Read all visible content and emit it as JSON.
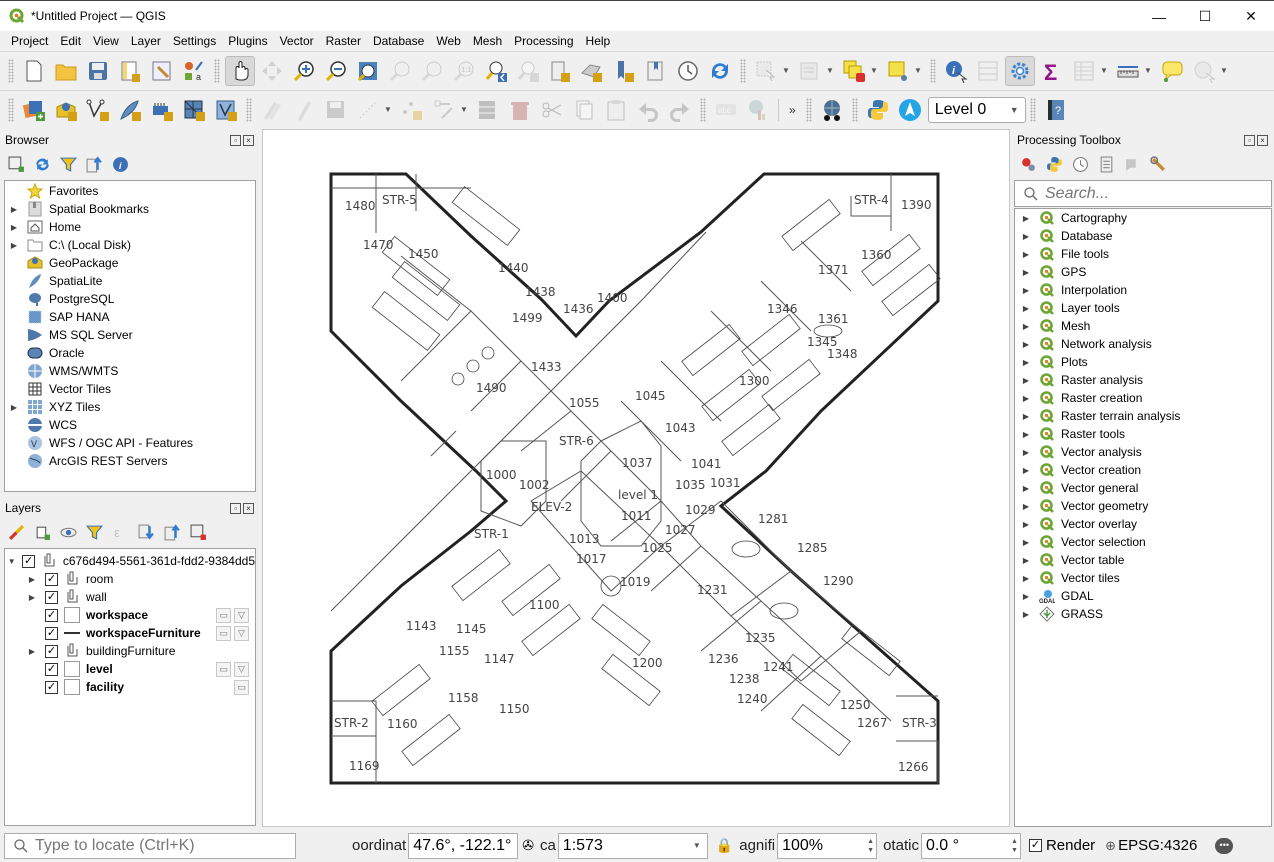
{
  "window": {
    "title": "*Untitled Project — QGIS",
    "minimize": "—",
    "maximize": "☐",
    "close": "✕"
  },
  "menubar": [
    "Project",
    "Edit",
    "View",
    "Layer",
    "Settings",
    "Plugins",
    "Vector",
    "Raster",
    "Database",
    "Web",
    "Mesh",
    "Processing",
    "Help"
  ],
  "toolbar_top": {
    "icons": [
      "new-project-icon",
      "open-project-icon",
      "save-project-icon",
      "new-print-layout-icon",
      "style-manager-icon",
      "layout-manager-icon",
      "pan-icon",
      "pan-to-selection-icon",
      "zoom-in-icon",
      "zoom-out-icon",
      "zoom-full-icon",
      "zoom-to-selection-icon",
      "zoom-to-layer-icon",
      "zoom-native-icon",
      "zoom-last-icon",
      "zoom-next-icon",
      "new-map-view-icon",
      "new-3d-map-icon",
      "new-bookmark-icon",
      "show-bookmarks-icon",
      "temporal-controller-icon",
      "refresh-icon",
      "select-features-icon",
      "select-by-value-icon",
      "deselect-icon",
      "select-by-location-icon",
      "identify-icon",
      "field-calculator-icon",
      "processing-toolbox-icon",
      "statistics-icon",
      "attribute-table-icon",
      "measure-icon",
      "map-tips-icon",
      "actions-icon"
    ],
    "active": "pan-icon"
  },
  "toolbar_bottom": {
    "level_selector": "Level 0",
    "more": "»"
  },
  "browser": {
    "title": "Browser",
    "items": [
      {
        "label": "Favorites",
        "icon": "star-icon",
        "expandable": false
      },
      {
        "label": "Spatial Bookmarks",
        "icon": "bookmark-icon",
        "expandable": true
      },
      {
        "label": "Home",
        "icon": "home-folder-icon",
        "expandable": true
      },
      {
        "label": "C:\\ (Local Disk)",
        "icon": "folder-icon",
        "expandable": true
      },
      {
        "label": "GeoPackage",
        "icon": "geopackage-icon",
        "expandable": false
      },
      {
        "label": "SpatiaLite",
        "icon": "feather-icon",
        "expandable": false
      },
      {
        "label": "PostgreSQL",
        "icon": "elephant-icon",
        "expandable": false
      },
      {
        "label": "SAP HANA",
        "icon": "hana-icon",
        "expandable": false
      },
      {
        "label": "MS SQL Server",
        "icon": "mssql-icon",
        "expandable": false
      },
      {
        "label": "Oracle",
        "icon": "oracle-icon",
        "expandable": false
      },
      {
        "label": "WMS/WMTS",
        "icon": "globe-icon",
        "expandable": false
      },
      {
        "label": "Vector Tiles",
        "icon": "grid-icon",
        "expandable": false
      },
      {
        "label": "XYZ Tiles",
        "icon": "tiles-icon",
        "expandable": true
      },
      {
        "label": "WCS",
        "icon": "wcs-globe-icon",
        "expandable": false
      },
      {
        "label": "WFS / OGC API - Features",
        "icon": "wfs-globe-icon",
        "expandable": false
      },
      {
        "label": "ArcGIS REST Servers",
        "icon": "arcgis-globe-icon",
        "expandable": false
      }
    ]
  },
  "layers": {
    "title": "Layers",
    "group": "c676d494-5561-361d-fdd2-9384dd5",
    "items": [
      {
        "label": "room",
        "type": "group",
        "bold": false,
        "checked": true,
        "expandable": true,
        "indicators": 0
      },
      {
        "label": "wall",
        "type": "group",
        "bold": false,
        "checked": true,
        "expandable": true,
        "indicators": 0
      },
      {
        "label": "workspace",
        "type": "polygon",
        "bold": true,
        "checked": true,
        "expandable": false,
        "indicators": 2
      },
      {
        "label": "workspaceFurniture",
        "type": "line",
        "bold": true,
        "checked": true,
        "expandable": false,
        "indicators": 2
      },
      {
        "label": "buildingFurniture",
        "type": "group",
        "bold": false,
        "checked": true,
        "expandable": true,
        "indicators": 0
      },
      {
        "label": "level",
        "type": "polygon",
        "bold": true,
        "checked": true,
        "expandable": false,
        "indicators": 2
      },
      {
        "label": "facility",
        "type": "polygon",
        "bold": true,
        "checked": true,
        "expandable": false,
        "indicators": 1
      }
    ]
  },
  "processing": {
    "title": "Processing Toolbox",
    "search_placeholder": "Search...",
    "items": [
      "Cartography",
      "Database",
      "File tools",
      "GPS",
      "Interpolation",
      "Layer tools",
      "Mesh",
      "Network analysis",
      "Plots",
      "Raster analysis",
      "Raster creation",
      "Raster terrain analysis",
      "Raster tools",
      "Vector analysis",
      "Vector creation",
      "Vector general",
      "Vector geometry",
      "Vector overlay",
      "Vector selection",
      "Vector table",
      "Vector tiles",
      "GDAL",
      "GRASS"
    ]
  },
  "map": {
    "rooms": [
      "STR-5",
      "1480",
      "1470",
      "1450",
      "1440",
      "1438",
      "1436",
      "1499",
      "1490",
      "1433",
      "1055",
      "STR-6",
      "1400",
      "STR-4",
      "1390",
      "1360",
      "1371",
      "1346",
      "1361",
      "1345",
      "1348",
      "1300",
      "1045",
      "1043",
      "1041",
      "1037",
      "level 1",
      "1035",
      "1031",
      "1011",
      "1029",
      "1027",
      "1025",
      "1000",
      "1002",
      "ELEV-2",
      "STR-1",
      "1013",
      "1017",
      "1019",
      "1100",
      "1143",
      "1145",
      "1147",
      "1155",
      "1158",
      "1150",
      "1160",
      "STR-2",
      "1169",
      "1200",
      "1231",
      "1236",
      "1238",
      "1240",
      "1241",
      "1235",
      "1250",
      "1267",
      "STR-3",
      "1266",
      "1281",
      "1285",
      "1290"
    ]
  },
  "statusbar": {
    "locate_placeholder": "Type to locate (Ctrl+K)",
    "coordinate_label": "oordinat",
    "coordinate": "47.6°, -122.1°",
    "scale_label": "ca",
    "scale": "1:573",
    "magnifier_label": "agnifi",
    "magnifier": "100%",
    "rotation_label": "otatic",
    "rotation": "0.0 °",
    "render_label": "Render",
    "render_checked": true,
    "crs": "EPSG:4326"
  }
}
